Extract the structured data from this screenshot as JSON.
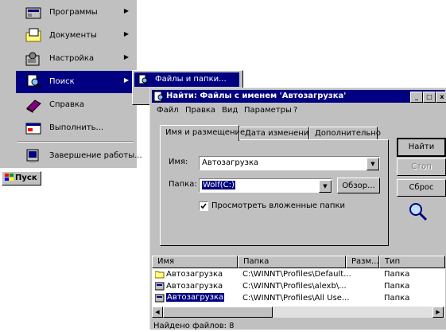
{
  "start_menu": {
    "items": [
      {
        "label": "Программы",
        "icon": "programs-icon",
        "has_arrow": true
      },
      {
        "label": "Документы",
        "icon": "documents-icon",
        "has_arrow": true
      },
      {
        "label": "Настройка",
        "icon": "settings-icon",
        "has_arrow": true
      },
      {
        "label": "Поиск",
        "icon": "search-icon",
        "has_arrow": true,
        "active": true
      },
      {
        "label": "Справка",
        "icon": "help-book-icon",
        "has_arrow": false
      },
      {
        "label": "Выполнить...",
        "icon": "run-icon",
        "has_arrow": false
      },
      {
        "label": "Завершение работы...",
        "icon": "shutdown-icon",
        "has_arrow": false
      }
    ],
    "submenu": {
      "label": "Файлы и папки..."
    },
    "start_button": "Пуск"
  },
  "find_window": {
    "title": "Найти: Файлы с именем 'Автозагрузка'",
    "menu": [
      "Файл",
      "Правка",
      "Вид",
      "Параметры",
      "?"
    ],
    "tabs": [
      "Имя и размещение",
      "Дата изменения",
      "Дополнительно"
    ],
    "name_label": "Имя:",
    "name_value": "Автозагрузка",
    "folder_label": "Папка:",
    "folder_value": "Wolf(C:)",
    "browse_button": "Обзор...",
    "subfolders_checkbox": "Просмотреть вложенные папки",
    "subfolders_checked": true,
    "buttons": {
      "find": "Найти",
      "stop": "Стоп",
      "reset": "Сброс"
    },
    "columns": [
      "Имя",
      "Папка",
      "Разм...",
      "Тип"
    ],
    "rows": [
      {
        "name": "Автозагрузка",
        "folder": "C:\\WINNT\\Profiles\\Default...",
        "type": "Папка",
        "icon": "folder-icon"
      },
      {
        "name": "Автозагрузка",
        "folder": "C:\\WINNT\\Profiles\\alexb\\...",
        "type": "Папка",
        "icon": "folder-programs-icon"
      },
      {
        "name": "Автозагрузка",
        "folder": "C:\\WINNT\\Profiles\\All Use...",
        "type": "Папка",
        "icon": "folder-programs-icon",
        "selected": true
      }
    ],
    "status": "Найдено файлов: 8"
  },
  "colors": {
    "face": "#c0c0c0",
    "title": "#000080",
    "highlight": "#000080"
  }
}
